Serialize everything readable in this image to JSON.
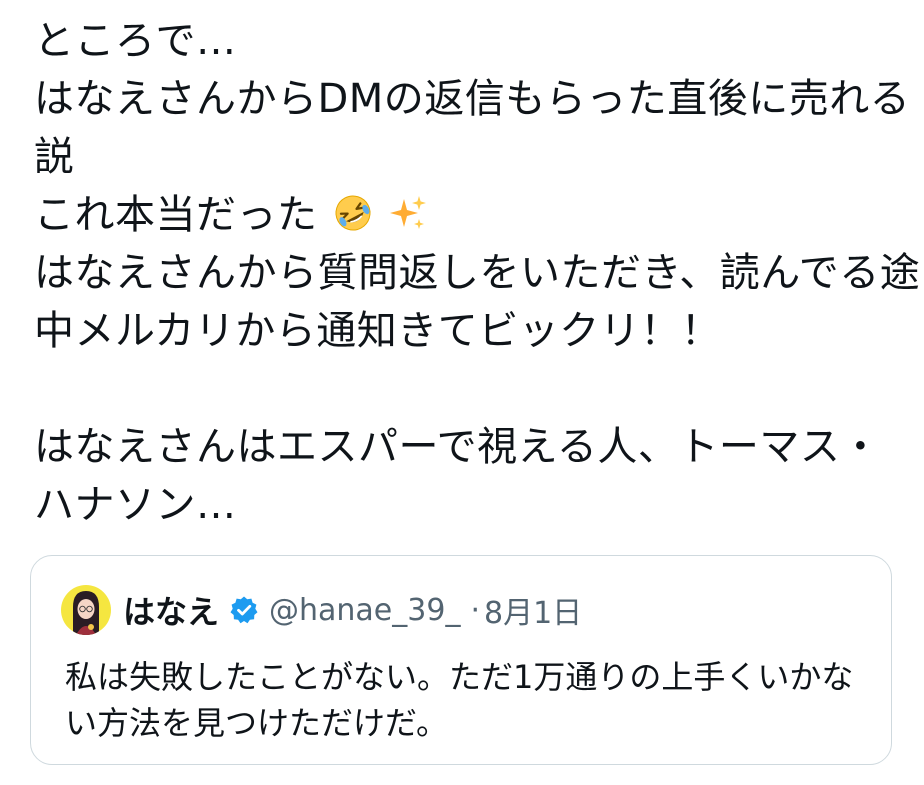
{
  "tweet": {
    "lines": [
      "ところで…",
      "はなえさんからDMの返信もらった直後に売れる",
      "説",
      "これ本当だった",
      "はなえさんから質問返しをいただき、読んでる途",
      "中メルカリから通知きてビックリ！！",
      "",
      "はなえさんはエスパーで視える人、トーマス・",
      "ハナソン…"
    ],
    "emojis": [
      "rolling-on-floor-laughing-icon",
      "sparkles-icon"
    ]
  },
  "quote": {
    "name": "はなえ",
    "handle": "@hanae_39_",
    "separator": "·",
    "date": "8月1日",
    "text_lines": [
      "私は失敗したことがない。ただ1万通りの上手くいかな",
      "い方法を見つけただけだ。"
    ],
    "verified_color": "#1d9bf0"
  }
}
